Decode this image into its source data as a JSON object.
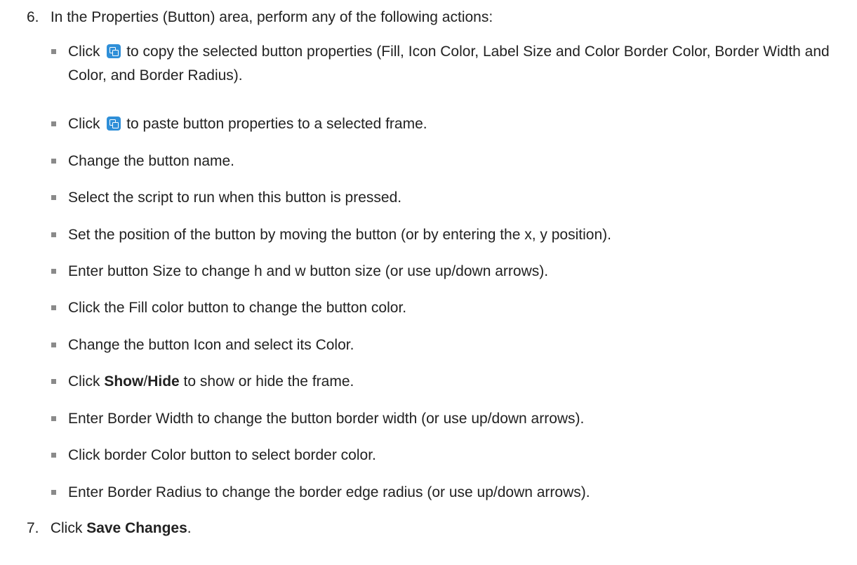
{
  "step6": {
    "number": "6.",
    "text": "In the Properties (Button) area, perform any of the following actions:"
  },
  "items": {
    "copy": {
      "before": "Click",
      "icon": "copy-icon",
      "after": "to copy the selected button properties (Fill, Icon Color, Label Size and Color Border Color, Border Width and Color, and Border Radius)."
    },
    "paste": {
      "before": "Click",
      "icon": "paste-icon",
      "after": "to paste button properties to a selected frame."
    },
    "name": "Change the button name.",
    "script": "Select the script to run when this button is pressed.",
    "position": "Set the position of the button by moving the button (or by entering the x, y position).",
    "size": "Enter button Size to change h and w button size (or use up/down arrows).",
    "fill": "Click the Fill color button to change the button color.",
    "icon": "Change the button Icon and select its Color.",
    "showhide": {
      "before": "Click",
      "show": "Show",
      "slash": "/",
      "hide": "Hide",
      "after": "to show or hide the frame."
    },
    "border_width": "Enter Border Width to change the button border width (or use up/down arrows).",
    "border_color": "Click border Color button to select border color.",
    "border_radius": "Enter Border Radius to change the border edge radius (or use up/down arrows)."
  },
  "step7": {
    "number": "7.",
    "before": "Click",
    "bold": "Save Changes",
    "after": "."
  },
  "colors": {
    "icon_bg": "#2f8fd8",
    "bullet": "#8a8a8a",
    "text": "#222222"
  }
}
